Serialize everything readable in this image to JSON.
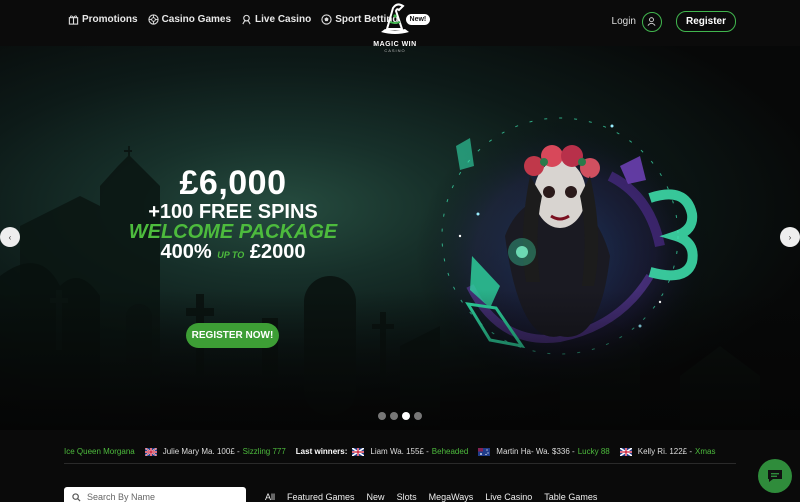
{
  "nav": {
    "links": [
      {
        "label": "Promotions",
        "icon": "gift-icon"
      },
      {
        "label": "Casino Games",
        "icon": "chip-icon"
      },
      {
        "label": "Live Casino",
        "icon": "dealer-icon"
      },
      {
        "label": "Sport Betting",
        "icon": "football-icon"
      }
    ],
    "new_badge": "New!",
    "logo_text": "MAGIC WIN",
    "logo_sub": "CASINO",
    "login_label": "Login",
    "register_label": "Register"
  },
  "hero": {
    "amount": "£6,000",
    "spins": "+100 FREE SPINS",
    "welcome": "WELCOME PACKAGE",
    "percent": "400%",
    "upto": "UP TO",
    "max_bonus": "£2000",
    "cta_label": "REGISTER NOW!",
    "prev_label": "‹",
    "next_label": "›",
    "slide_count": 4,
    "active_slide": 3
  },
  "winners": {
    "leading_game": "Ice Queen Morgana",
    "last_winners_label": "Last winners:",
    "entries_before": [
      {
        "name": "Julie Mary Ma.",
        "amount": "100£",
        "game": "Sizzling 777",
        "flag": "uk"
      }
    ],
    "entries_after": [
      {
        "name": "Liam Wa.",
        "amount": "155£",
        "game": "Beheaded",
        "flag": "uk"
      },
      {
        "name": "Martin Ha- Wa.",
        "amount": "$336",
        "game": "Lucky 88",
        "flag": "au"
      },
      {
        "name": "Kelly Ri.",
        "amount": "122£",
        "game": "Xmas",
        "flag": "uk"
      }
    ]
  },
  "search": {
    "placeholder": "Search By Name"
  },
  "categories": [
    "All",
    "Featured Games",
    "New",
    "Slots",
    "MegaWays",
    "Live Casino",
    "Table Games"
  ],
  "colors": {
    "accent_green": "#41b64e",
    "cta_green": "#3d9e35",
    "text_green": "#4dbb3d"
  }
}
